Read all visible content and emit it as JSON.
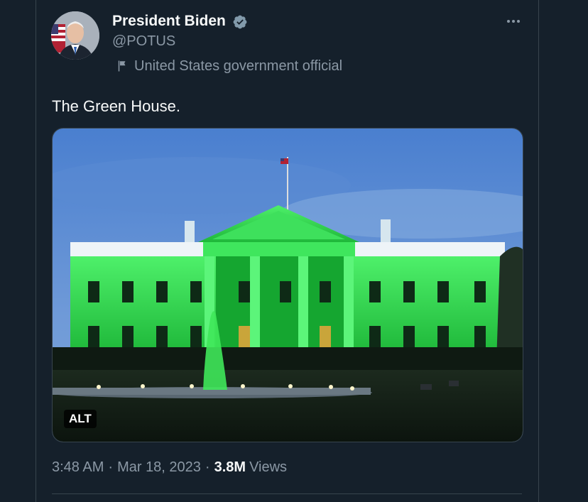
{
  "author": {
    "display_name": "President Biden",
    "handle": "@POTUS",
    "label": "United States government official"
  },
  "tweet": {
    "text": "The Green House.",
    "media_alt_badge": "ALT"
  },
  "meta": {
    "time": "3:48 AM",
    "date": "Mar 18, 2023",
    "separator": "·",
    "views_count": "3.8M",
    "views_label": "Views"
  },
  "colors": {
    "background": "#15202b",
    "primary_text": "#f7f9f9",
    "secondary_text": "#8b98a5",
    "border": "#38444d",
    "verified": "#829aab"
  },
  "icons": {
    "verified": "verified-badge-icon",
    "label": "flag-icon",
    "more": "more-dots-icon"
  }
}
